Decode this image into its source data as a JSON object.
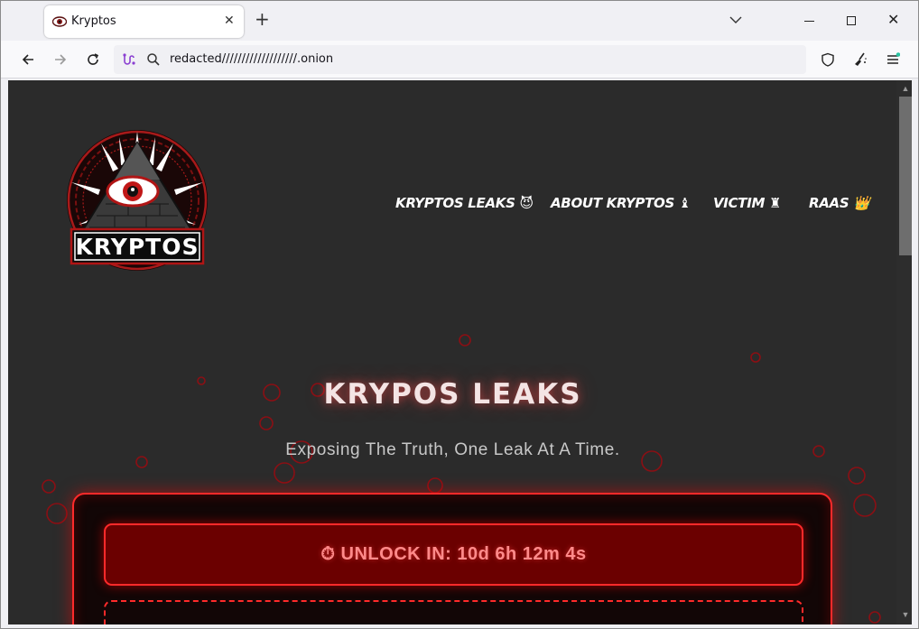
{
  "browser": {
    "tab": {
      "title": "Kryptos",
      "icon": "eye-icon"
    },
    "url": "redacted///////////////////.onion"
  },
  "site": {
    "logo_text": "KRYPTOS",
    "nav": [
      {
        "label": "KRYPTOS LEAKS 😈"
      },
      {
        "label": "ABOUT KRYPTOS ♝"
      },
      {
        "label": "VICTIM ♜"
      },
      {
        "label": "RAAS 👑"
      }
    ],
    "hero_title": "KRYPOS LEAKS",
    "hero_subtitle": "Exposing The Truth, One Leak At A Time.",
    "unlock_label": "⏱ UNLOCK IN: 10d 6h 12m 4s"
  },
  "colors": {
    "accent": "#ff2a2a",
    "background": "#2b2b2b"
  }
}
